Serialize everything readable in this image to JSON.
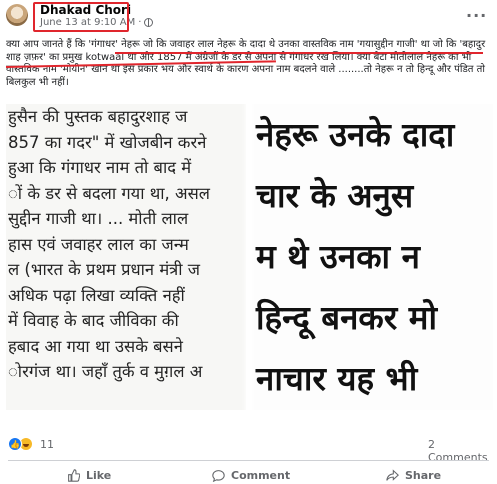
{
  "post": {
    "author": "Dhakad Chori",
    "timestamp": "June 13 at 9:10 AM",
    "more_label": "···",
    "caption": "क्या आप जानते हैं कि 'गंगाधर' नेहरू जो कि जवाहर लाल नेहरू के दादा थे उनका वास्तविक नाम 'गयासुद्दीन गाजी' था जो कि 'बहादुर शाह ज़फ़र' का प्रमुख kotwaal था और 1857 में अंग्रेजों के डर से अपना से गंगाधर रख लिया। क्या बेटा मोतीलाल नेहरू का भी वास्तविक नाम 'मोयीन' खान था इस प्रकार भय और स्वार्थ के कारण अपना नाम बदलने वाले ........तो नेहरू न तो हिन्दू और पंडित तो बिलकुल भी नहीं।"
  },
  "image_left": {
    "lines": [
      "हुसैन की पुस्तक बहादुरशाह ज",
      "857 का गदर\" में खोजबीन करने",
      "हुआ कि गंगाधर नाम तो बाद में",
      "ों के डर से बदला गया था, असल",
      "सुद्दीन गाजी था। ... मोती लाल",
      "हास एवं जवाहर लाल का जन्म",
      "ल (भारत के प्रथम प्रधान मंत्री ज",
      "अधिक पढ़ा लिखा व्यक्ति नहीं",
      "में विवाह के बाद जीविका की",
      "हबाद आ गया था उसके बसने",
      "ोरगंज था। जहाँ तुर्क व मुग़ल अ"
    ]
  },
  "image_right": {
    "lines": [
      "नेहरू उनके दादा",
      "चार के अनुस",
      "म थे उनका न",
      "हिन्दू बनकर मो",
      "नाचार यह भी"
    ]
  },
  "reactions": {
    "count": "11",
    "comments": "2 Comments"
  },
  "actions": {
    "like": "Like",
    "comment": "Comment",
    "share": "Share"
  },
  "colors": {
    "highlight_red": "#e0262d",
    "like_blue": "#1877f2",
    "muted_text": "#65676b"
  }
}
